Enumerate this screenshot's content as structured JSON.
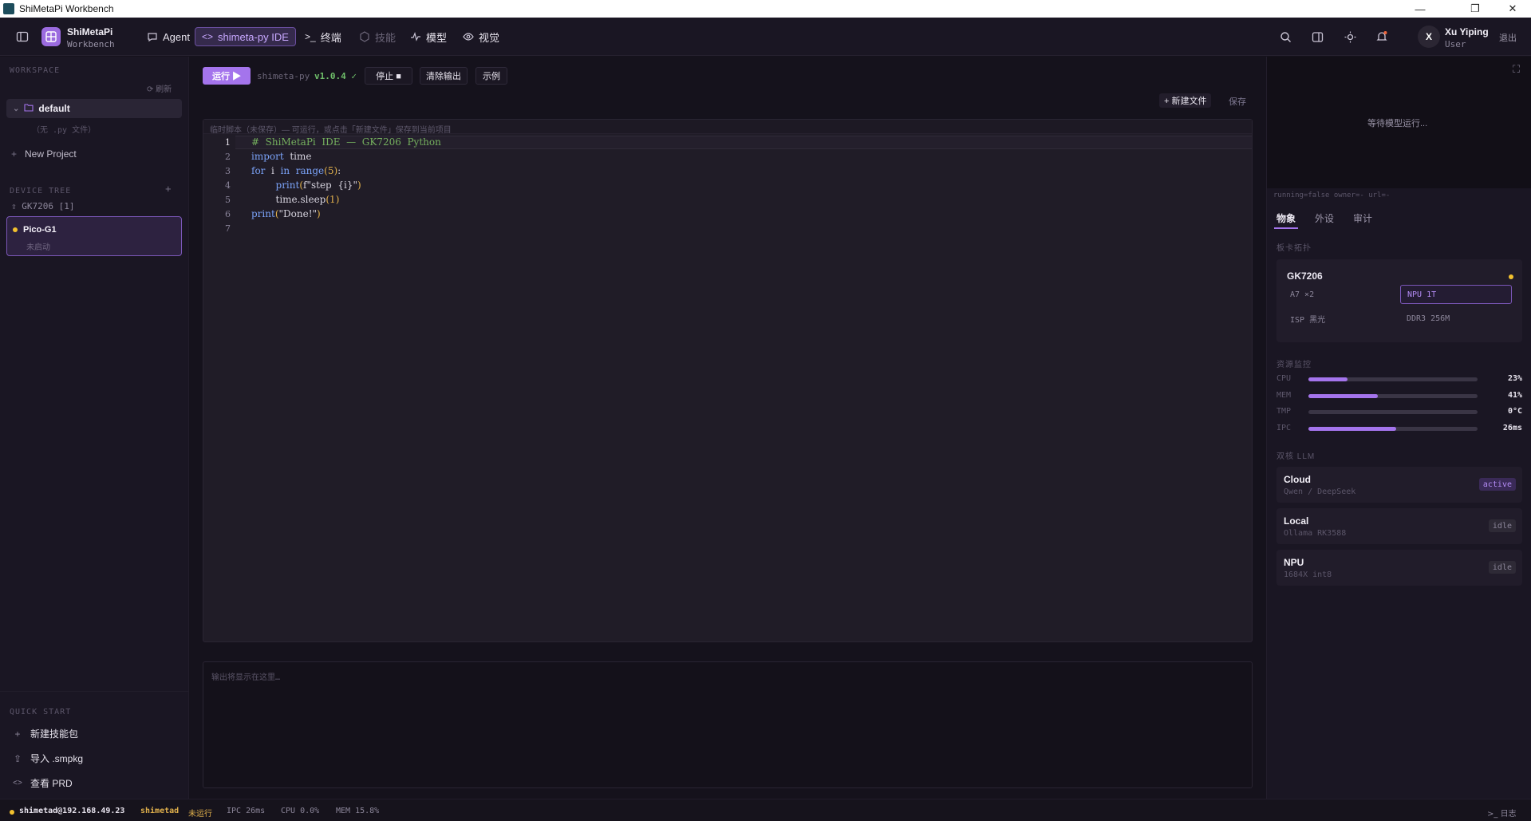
{
  "window": {
    "title": "ShiMetaPi Workbench"
  },
  "header": {
    "brand_name": "ShiMetaPi",
    "brand_sub": "Workbench",
    "tabs": [
      {
        "icon": "chat-icon",
        "label": "Agent"
      },
      {
        "icon": "code-icon",
        "label": "shimeta-py IDE",
        "active": true
      },
      {
        "icon": "terminal-icon",
        "label": "终端"
      },
      {
        "icon": "cube-icon",
        "label": "技能",
        "disabled": true
      },
      {
        "icon": "pulse-icon",
        "label": "模型"
      },
      {
        "icon": "eye-icon",
        "label": "视觉"
      }
    ],
    "user": {
      "initial": "X",
      "name": "Xu Yiping",
      "role": "User",
      "logout": "退出"
    }
  },
  "sidebar": {
    "workspace_label": "WORKSPACE",
    "refresh_label": "刷新",
    "project": {
      "name": "default",
      "empty": "（无 .py 文件）"
    },
    "new_project": "New Project",
    "device_tree_label": "DEVICE TREE",
    "devices": [
      {
        "name": "GK7206 [1]"
      },
      {
        "name": "Pico-G1",
        "state": "未启动"
      }
    ],
    "quick_start_label": "QUICK START",
    "quick_start": [
      {
        "icon": "plus-icon",
        "label": "新建技能包"
      },
      {
        "icon": "upload-icon",
        "label": "导入 .smpkg"
      },
      {
        "icon": "code-icon",
        "label": "查看 PRD"
      }
    ]
  },
  "toolbar": {
    "run": "运行 ▶",
    "pkg_name": "shimeta-py",
    "pkg_version": "v1.0.4 ✓",
    "stop": "停止 ■",
    "clear": "清除输出",
    "example": "示例",
    "new_file": "+ 新建文件",
    "save": "保存"
  },
  "editor": {
    "hint": "临时脚本（未保存）— 可运行，或点击「新建文件」保存到当前项目",
    "line_numbers": [
      "1",
      "2",
      "3",
      "4",
      "5",
      "6",
      "7"
    ]
  },
  "output": {
    "placeholder": "输出将显示在这里…"
  },
  "right": {
    "preview_text": "等待模型运行...",
    "status_line": "running=false owner=- url=-",
    "tabs": [
      "物象",
      "外设",
      "审计"
    ],
    "board_label": "板卡拓扑",
    "board": {
      "name": "GK7206",
      "chips": [
        "A7 ×2",
        "NPU 1T",
        "ISP 黑光",
        "DDR3 256M"
      ]
    },
    "resource_label": "资源监控",
    "resources": [
      {
        "label": "CPU",
        "value": "23%",
        "level": 0.23
      },
      {
        "label": "MEM",
        "value": "41%",
        "level": 0.41
      },
      {
        "label": "TMP",
        "value": "0°C",
        "level": 0
      },
      {
        "label": "IPC",
        "value": "26ms",
        "level": 0.52
      }
    ],
    "llm_label": "双核 LLM",
    "llms": [
      {
        "title": "Cloud",
        "sub": "Qwen / DeepSeek",
        "badge": "active"
      },
      {
        "title": "Local",
        "sub": "Ollama RK3588",
        "badge": "idle"
      },
      {
        "title": "NPU",
        "sub": "1684X int8",
        "badge": "idle"
      }
    ]
  },
  "statusbar": {
    "host": "shimetad@192.168.49.23",
    "service": "shimetad",
    "service_state": "未运行",
    "ipc": "IPC 26ms",
    "cpu": "CPU 0.0%",
    "mem": "MEM 15.8%",
    "log": "日志"
  },
  "colors": {
    "accent": "#a474ec",
    "warning_dot": "#f2c12e",
    "ok": "#6fbf6a"
  }
}
